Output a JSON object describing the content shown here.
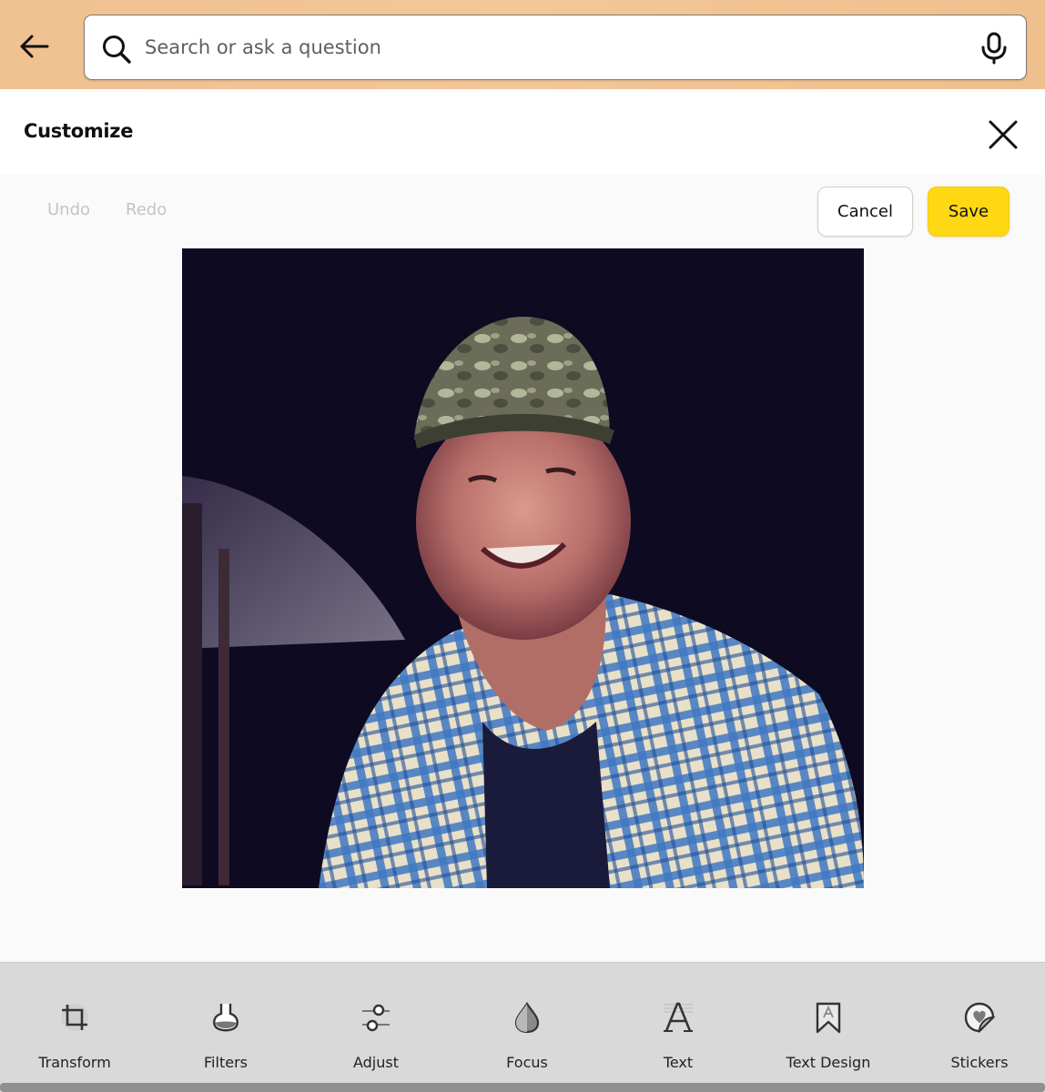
{
  "search": {
    "placeholder": "Search or ask a question"
  },
  "header": {
    "title": "Customize"
  },
  "edit_bar": {
    "undo_label": "Undo",
    "redo_label": "Redo",
    "cancel_label": "Cancel",
    "save_label": "Save"
  },
  "tools": [
    {
      "label": "Transform",
      "icon": "crop-icon"
    },
    {
      "label": "Filters",
      "icon": "flask-icon"
    },
    {
      "label": "Adjust",
      "icon": "sliders-icon"
    },
    {
      "label": "Focus",
      "icon": "droplet-icon"
    },
    {
      "label": "Text",
      "icon": "text-a-icon"
    },
    {
      "label": "Text Design",
      "icon": "bookmark-a-icon"
    },
    {
      "label": "Stickers",
      "icon": "sticker-heart-icon"
    }
  ],
  "colors": {
    "top_bar": "#f3c796",
    "save_button": "#ffd814",
    "tool_bar": "#d9d9d9"
  }
}
